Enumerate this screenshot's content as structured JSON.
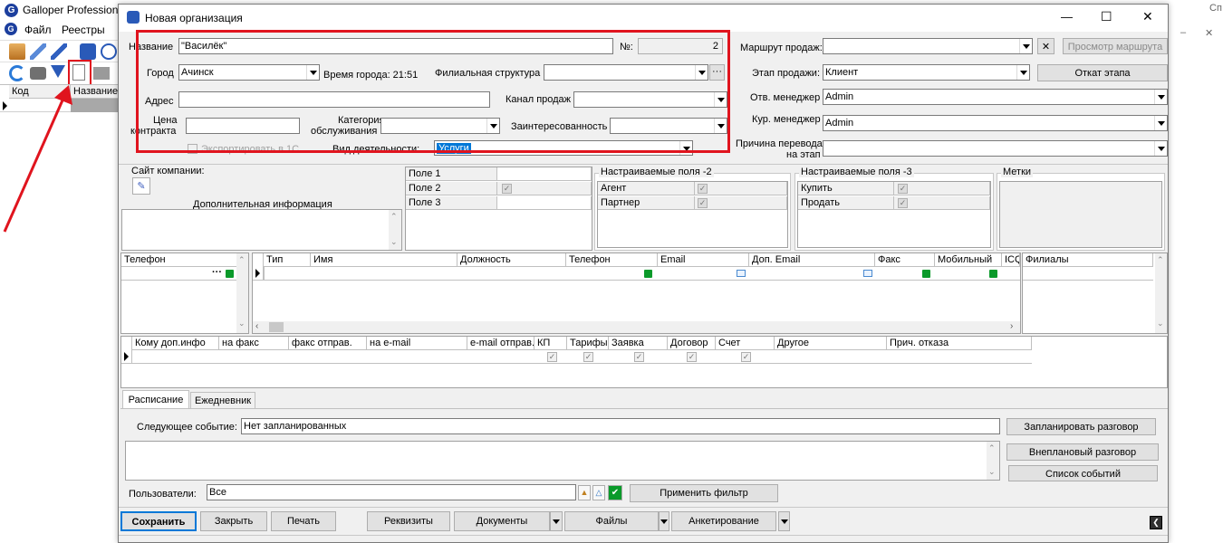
{
  "bg_app": {
    "title": "Galloper Professiona",
    "menu": [
      "Файл",
      "Реестры"
    ],
    "grid_headers": [
      "Код",
      "Название"
    ],
    "right_fragment": "Сп",
    "right_dash": "–"
  },
  "dialog": {
    "title": "Новая организация",
    "controls": {
      "minimize": "—",
      "maximize": "☐",
      "close": "✕"
    }
  },
  "form": {
    "name_label": "Название",
    "name_value": "\"Василёк\"",
    "number_label": "№:",
    "number_value": "2",
    "city_label": "Город",
    "city_value": "Ачинск",
    "city_time": "Время города: 21:51",
    "branch_label": "Филиальная структура",
    "branch_value": "",
    "branch_button": "···",
    "address_label": "Адрес",
    "address_value": "",
    "channel_label": "Канал продаж",
    "channel_value": "",
    "price_label_1": "Цена",
    "price_label_2": "контракта",
    "price_value": "",
    "category_label_1": "Категория",
    "category_label_2": "обслуживания",
    "category_value": "",
    "interest_label": "Заинтересованность",
    "interest_value": "",
    "export_label": "Экспортировать в 1С",
    "activity_label": "Вид деятельности:",
    "activity_value": "Услуги"
  },
  "right_panel": {
    "route_label": "Маршрут продаж:",
    "route_value": "",
    "route_clear": "✕",
    "route_view": "Просмотр маршрута",
    "stage_label": "Этап продажи:",
    "stage_value": "Клиент",
    "stage_back": "Откат этапа",
    "resp_label": "Отв. менеджер",
    "resp_value": "Admin",
    "cur_label": "Кур. менеджер",
    "cur_value": "Admin",
    "reason_label_1": "Причина перевода",
    "reason_label_2": "на этап",
    "reason_value": ""
  },
  "middle": {
    "site_label": "Сайт компании:",
    "extra_info_label": "Дополнительная информация",
    "fields": [
      "Поле 1",
      "Поле 2",
      "Поле 3"
    ],
    "custom2_title": "Настраиваемые поля -2",
    "custom2_rows": [
      "Агент",
      "Партнер"
    ],
    "custom3_title": "Настраиваемые поля -3",
    "custom3_rows": [
      "Купить",
      "Продать"
    ],
    "tags_title": "Метки"
  },
  "contacts": {
    "phone_header": "Телефон",
    "phone_btn": "···",
    "headers": [
      "Тип",
      "Имя",
      "Должность",
      "Телефон",
      "Email",
      "Доп. Email",
      "Факс",
      "Мобильный",
      "ICQ"
    ],
    "branches_header": "Филиалы"
  },
  "dist": {
    "headers": [
      "Кому доп.инфо",
      "на факс",
      "факс отправ.",
      "на e-mail",
      "e-mail отправ.",
      "КП",
      "Тарифы",
      "Заявка",
      "Договор",
      "Счет",
      "Другое",
      "Прич. отказа"
    ]
  },
  "tabs": [
    "Расписание",
    "Ежедневник"
  ],
  "schedule": {
    "next_label": "Следующее событие:",
    "next_value": "Нет запланированных",
    "plan_btn": "Запланировать разговор",
    "unplanned_btn": "Внеплановый разговор",
    "events_btn": "Список событий",
    "users_label": "Пользователи:",
    "users_value": "Все",
    "apply_btn": "Применить фильтр"
  },
  "footer": {
    "save": "Сохранить",
    "close": "Закрыть",
    "print": "Печать",
    "requisites": "Реквизиты",
    "documents": "Документы",
    "files": "Файлы",
    "survey": "Анкетирование"
  },
  "colors": {
    "highlight": "#e0141e",
    "selection": "#0078d7",
    "green": "#0a9a2a"
  }
}
